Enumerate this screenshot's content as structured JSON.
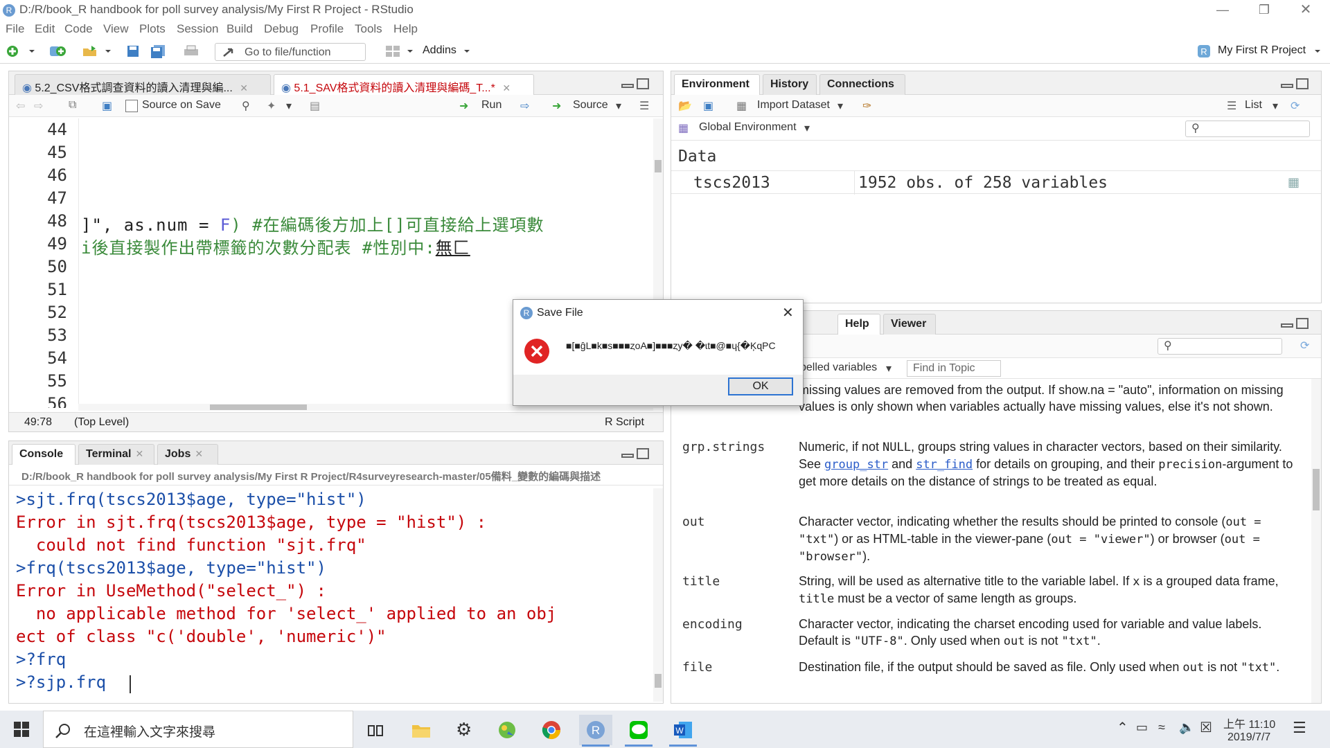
{
  "window": {
    "title": "D:/R/book_R handbook for poll survey analysis/My First R Project - RStudio"
  },
  "menu": [
    "File",
    "Edit",
    "Code",
    "View",
    "Plots",
    "Session",
    "Build",
    "Debug",
    "Profile",
    "Tools",
    "Help"
  ],
  "toolbar": {
    "goto_placeholder": "Go to file/function",
    "addins": "Addins",
    "project": "My First R Project"
  },
  "editor": {
    "tabs": [
      {
        "label": "5.2_CSV格式調查資料的讀入清理與編...",
        "active": false
      },
      {
        "label": "5.1_SAV格式資料的讀入清理與編碼_T...*",
        "active": true
      }
    ],
    "source_on_save": "Source on Save",
    "run": "Run",
    "source": "Source",
    "lines": [
      "44",
      "45",
      "46",
      "47",
      "48",
      "49",
      "50",
      "51",
      "52",
      "53",
      "54",
      "55",
      "56"
    ],
    "code48a": "]\", as.num = ",
    "code48b": "F",
    "code48c": ")  #在編碼後方加上[]可直接給上選項數",
    "code49a": "i後直接製作出帶標籤的次數分配表 #性別中:",
    "code49b": "無匚",
    "status_pos": "49:78",
    "status_level": "(Top Level)",
    "status_type": "R Script"
  },
  "console": {
    "tabs": [
      "Console",
      "Terminal",
      "Jobs"
    ],
    "path": "D:/R/book_R handbook for poll survey analysis/My First R Project/R4surveyresearch-master/05備料_變數的編碼與描述",
    "lines": [
      {
        "text": ">sjt.frq(tscs2013$age, type=\"hist\")",
        "cls": "blue"
      },
      {
        "text": "Error in sjt.frq(tscs2013$age, type = \"hist\") :",
        "cls": "red"
      },
      {
        "text": "  could not find function \"sjt.frq\"",
        "cls": "red"
      },
      {
        "text": ">frq(tscs2013$age, type=\"hist\")",
        "cls": "blue"
      },
      {
        "text": "Error in UseMethod(\"select_\") :",
        "cls": "red"
      },
      {
        "text": "  no applicable method for 'select_' applied to an obj",
        "cls": "red"
      },
      {
        "text": "ect of class \"c('double', 'numeric')\"",
        "cls": "red"
      },
      {
        "text": ">?frq",
        "cls": "blue"
      },
      {
        "text": ">?sjp.frq",
        "cls": "blue"
      }
    ]
  },
  "environment": {
    "tabs": [
      "Environment",
      "History",
      "Connections"
    ],
    "import": "Import Dataset",
    "list": "List",
    "scope": "Global Environment",
    "section": "Data",
    "row_name": "tscs2013",
    "row_value": "1952 obs. of 258 variables"
  },
  "help": {
    "tabs": [
      "ges",
      "Help",
      "Viewer"
    ],
    "topic": "belled variables",
    "find": "Find in Topic",
    "intro": "missing values are removed from the output. If show.na = \"auto\", information on missing values is only shown when variables actually have missing values, else it's not shown.",
    "args": [
      {
        "name": "grp.strings"
      },
      {
        "name": "out"
      },
      {
        "name": "title"
      },
      {
        "name": "encoding"
      },
      {
        "name": "file"
      }
    ],
    "t_grp1": "Numeric, if not ",
    "t_grp2": "NULL",
    "t_grp3": ", groups string values in character vectors, based on their similarity. See ",
    "t_grp4": "group_str",
    "t_grp5": " and ",
    "t_grp6": "str_find",
    "t_grp7": " for details on grouping, and their ",
    "t_grp8": "precision",
    "t_grp9": "-argument to get more details on the distance of strings to be treated as equal.",
    "t_out1": "Character vector, indicating whether the results should be printed to console (",
    "t_out2": "out = \"txt\"",
    "t_out3": ") or as HTML-table in the viewer-pane (",
    "t_out4": "out = \"viewer\"",
    "t_out5": ") or browser (",
    "t_out6": "out = \"browser\"",
    "t_out7": ").",
    "t_title1": "String, will be used as alternative title to the variable label. If ",
    "t_title2": "x",
    "t_title3": " is a grouped data frame, ",
    "t_title4": "title",
    "t_title5": " must be a vector of same length as groups.",
    "t_enc1": "Character vector, indicating the charset encoding used for variable and value labels. Default is ",
    "t_enc2": "\"UTF-8\"",
    "t_enc3": ". Only used when ",
    "t_enc4": "out",
    "t_enc5": " is not ",
    "t_enc6": "\"txt\"",
    "t_enc7": ".",
    "t_file1": "Destination file, if the output should be saved as file. Only used when ",
    "t_file2": "out",
    "t_file3": " is not ",
    "t_file4": "\"txt\"",
    "t_file5": "."
  },
  "dialog": {
    "title": "Save File",
    "message": "■[■ĝL■k■s■■■ȥoA■]■■■ȥy� �ɩt■@■ɥ{�ĶɋPC",
    "ok": "OK"
  },
  "taskbar": {
    "search": "在這裡輸入文字來搜尋",
    "time": "上午 11:10",
    "date": "2019/7/7"
  }
}
